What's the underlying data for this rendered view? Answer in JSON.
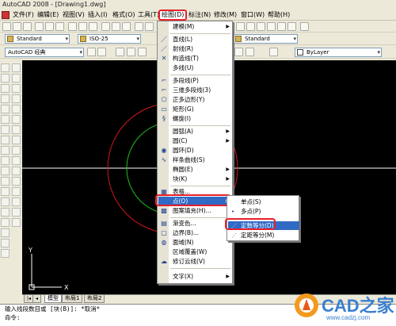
{
  "window": {
    "title": "AutoCAD 2008 - [Drawing1.dwg]"
  },
  "menubar": {
    "items": [
      {
        "label": "文件(F)"
      },
      {
        "label": "编辑(E)"
      },
      {
        "label": "视图(V)"
      },
      {
        "label": "插入(I)"
      },
      {
        "label": "格式(O)"
      },
      {
        "label": "工具(T)"
      },
      {
        "label": "绘图(D)"
      },
      {
        "label": "标注(N)"
      },
      {
        "label": "修改(M)"
      },
      {
        "label": "窗口(W)"
      },
      {
        "label": "帮助(H)"
      }
    ],
    "active": "绘图(D)"
  },
  "toolbars": {
    "text_style": "Standard",
    "dim_style": "ISO-25",
    "table_style": "Standard",
    "workspace": "AutoCAD 经典",
    "linetype": "ByLayer"
  },
  "draw_menu": {
    "items": [
      {
        "label": "建模(M)",
        "submenu": true
      },
      {
        "label": "直线(L)"
      },
      {
        "label": "射线(R)"
      },
      {
        "label": "构造线(T)"
      },
      {
        "label": "多线(U)"
      },
      {
        "label": "多段线(P)"
      },
      {
        "label": "三维多段线(3)"
      },
      {
        "label": "正多边形(Y)"
      },
      {
        "label": "矩形(G)"
      },
      {
        "label": "螺旋(I)"
      },
      {
        "label": "圆弧(A)",
        "submenu": true
      },
      {
        "label": "圆(C)",
        "submenu": true
      },
      {
        "label": "圆环(D)"
      },
      {
        "label": "样条曲线(S)"
      },
      {
        "label": "椭圆(E)",
        "submenu": true
      },
      {
        "label": "块(K)",
        "submenu": true
      },
      {
        "label": "表格..."
      },
      {
        "label": "点(O)",
        "submenu": true
      },
      {
        "label": "图案填充(H)..."
      },
      {
        "label": "渐变色..."
      },
      {
        "label": "边界(B)..."
      },
      {
        "label": "面域(N)"
      },
      {
        "label": "区域覆盖(W)"
      },
      {
        "label": "修订云线(V)"
      },
      {
        "label": "文字(X)",
        "submenu": true
      }
    ]
  },
  "point_submenu": {
    "items": [
      {
        "label": "单点(S)"
      },
      {
        "label": "多点(P)"
      },
      {
        "label": "定数等分(D)"
      },
      {
        "label": "定距等分(M)"
      }
    ]
  },
  "layout_tabs": [
    "模型",
    "布局1",
    "布局2"
  ],
  "command_line": {
    "line1": "输入线段数目或 [块(B)]: *取消*",
    "line2": "命令:"
  },
  "watermark": {
    "text": "CAD之家",
    "url": "www.cadzj.com"
  },
  "colors": {
    "highlight": "#316ac5",
    "annotation_red": "#e8202a",
    "circle_red": "#d01818",
    "circle_green": "#20c020"
  }
}
